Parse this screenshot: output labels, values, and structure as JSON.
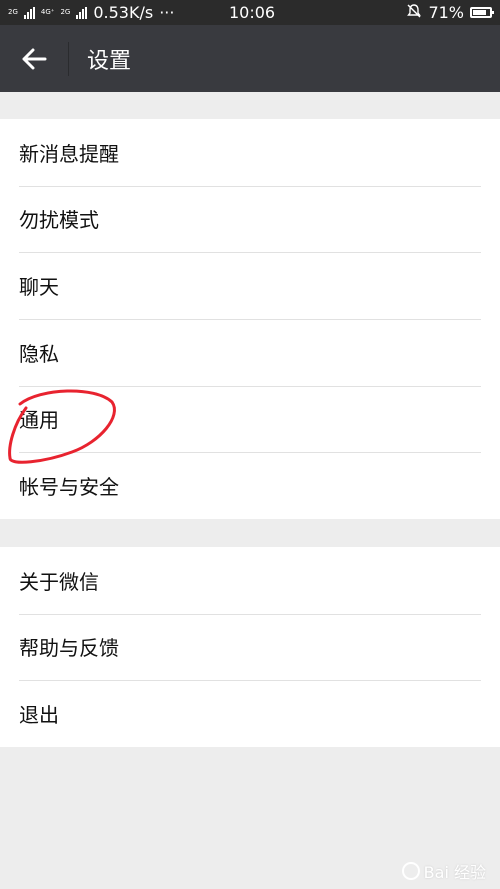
{
  "status_bar": {
    "net_top_1": "2G",
    "net_top_2": "4G⁺",
    "net_bottom_2": "2G",
    "net_top_3": "4G",
    "speed": "0.53K/s",
    "dots": "···",
    "time": "10:06",
    "battery_percent": "71%",
    "battery_level": 0.71
  },
  "header": {
    "title": "设置",
    "back_icon": "arrow-left-icon"
  },
  "menu_section_1": [
    {
      "label": "新消息提醒"
    },
    {
      "label": "勿扰模式"
    },
    {
      "label": "聊天"
    },
    {
      "label": "隐私"
    },
    {
      "label": "通用"
    },
    {
      "label": "帐号与安全"
    }
  ],
  "menu_section_2": [
    {
      "label": "关于微信"
    },
    {
      "label": "帮助与反馈"
    },
    {
      "label": "退出"
    }
  ],
  "annotation": {
    "color": "#e8232f",
    "target": "通用"
  },
  "watermark": {
    "text": "Bai 经验"
  },
  "colors": {
    "status_bar": "#2b2b2b",
    "header": "#393a3f",
    "background": "#ededed",
    "row": "#ffffff"
  }
}
